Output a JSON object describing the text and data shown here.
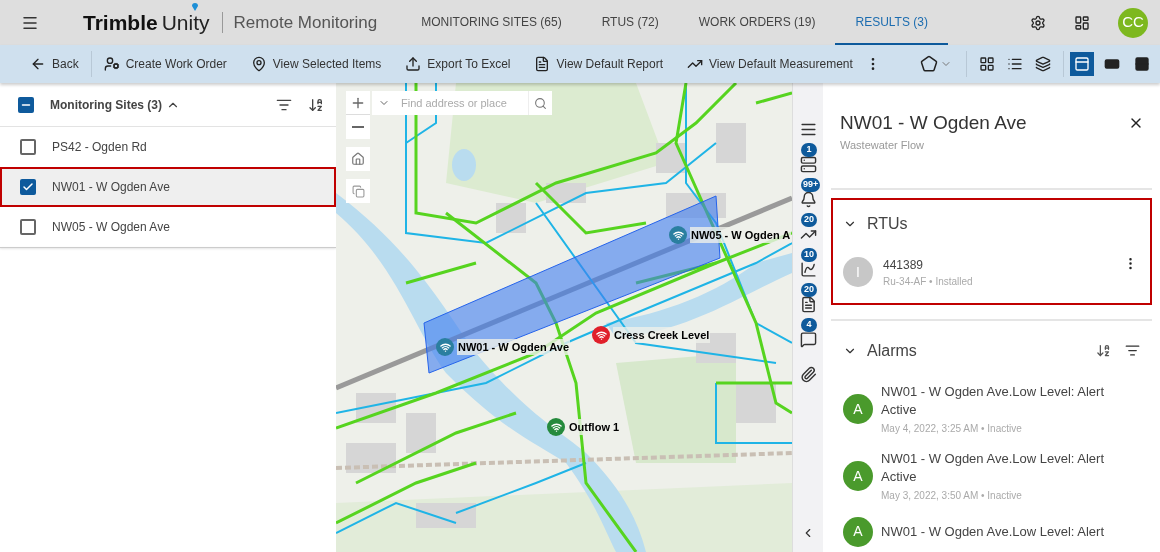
{
  "header": {
    "logo": {
      "name": "Trimble",
      "product": "Unity"
    },
    "app_title": "Remote Monitoring",
    "tabs": [
      {
        "label": "MONITORING SITES (65)",
        "selected": false
      },
      {
        "label": "RTUS (72)",
        "selected": false
      },
      {
        "label": "WORK ORDERS (19)",
        "selected": false
      },
      {
        "label": "RESULTS (3)",
        "selected": true
      }
    ],
    "avatar": "CC"
  },
  "toolbar": {
    "actions": [
      {
        "kind": "back",
        "label": "Back"
      },
      {
        "kind": "work-order",
        "label": "Create Work Order"
      },
      {
        "kind": "pin",
        "label": "View Selected Items"
      },
      {
        "kind": "export",
        "label": "Export To Excel"
      },
      {
        "kind": "report",
        "label": "View Default Report"
      },
      {
        "kind": "measure",
        "label": "View Default Measurement"
      }
    ],
    "layouts": [
      {
        "kind": "split",
        "selected": true
      },
      {
        "kind": "wide",
        "selected": false
      },
      {
        "kind": "rows",
        "selected": false
      }
    ]
  },
  "sites_panel": {
    "title": "Monitoring Sites (3)",
    "partial": true,
    "expanded": true,
    "items": [
      {
        "label": "PS42 - Ogden Rd",
        "checked": false,
        "selected": false
      },
      {
        "label": "NW01 - W Ogden Ave",
        "checked": true,
        "selected": true
      },
      {
        "label": "NW05 - W Ogden Ave",
        "checked": false,
        "selected": false
      }
    ]
  },
  "map": {
    "search": {
      "placeholder": "Find address or place"
    },
    "markers": [
      {
        "label": "NW05 - W Ogden A",
        "color": "#2a7fa0"
      },
      {
        "label": "NW01 - W Ogden Ave",
        "color": "#2a7fa0"
      },
      {
        "label": "Cress Creek Level",
        "color": "#e0202a"
      },
      {
        "label": "Outflow 1",
        "color": "#258a3c"
      }
    ]
  },
  "rail": [
    {
      "kind": "list"
    },
    {
      "kind": "device",
      "badge": "1"
    },
    {
      "kind": "bell",
      "badge": "99+"
    },
    {
      "kind": "trend",
      "badge": "20"
    },
    {
      "kind": "chart",
      "badge": "10"
    },
    {
      "kind": "doc",
      "badge": "20"
    },
    {
      "kind": "comment",
      "badge": "4"
    },
    {
      "kind": "clip"
    }
  ],
  "details": {
    "title": "NW01 - W Ogden Ave",
    "subtitle": "Wastewater Flow",
    "rtus": {
      "title": "RTUs",
      "expanded": true,
      "highlighted": true,
      "items": [
        {
          "initial": "I",
          "name": "441389",
          "meta": "Ru-34-AF • Installed"
        }
      ]
    },
    "alarms": {
      "title": "Alarms",
      "expanded": true,
      "items": [
        {
          "initial": "A",
          "title": "NW01 - W Ogden Ave.Low Level: Alert Active",
          "time": "May 4, 2022, 3:25 AM • Inactive"
        },
        {
          "initial": "A",
          "title": "NW01 - W Ogden Ave.Low Level: Alert Active",
          "time": "May 3, 2022, 3:50 AM • Inactive"
        },
        {
          "initial": "A",
          "title": "NW01 - W Ogden Ave.Low Level: Alert"
        }
      ]
    }
  }
}
